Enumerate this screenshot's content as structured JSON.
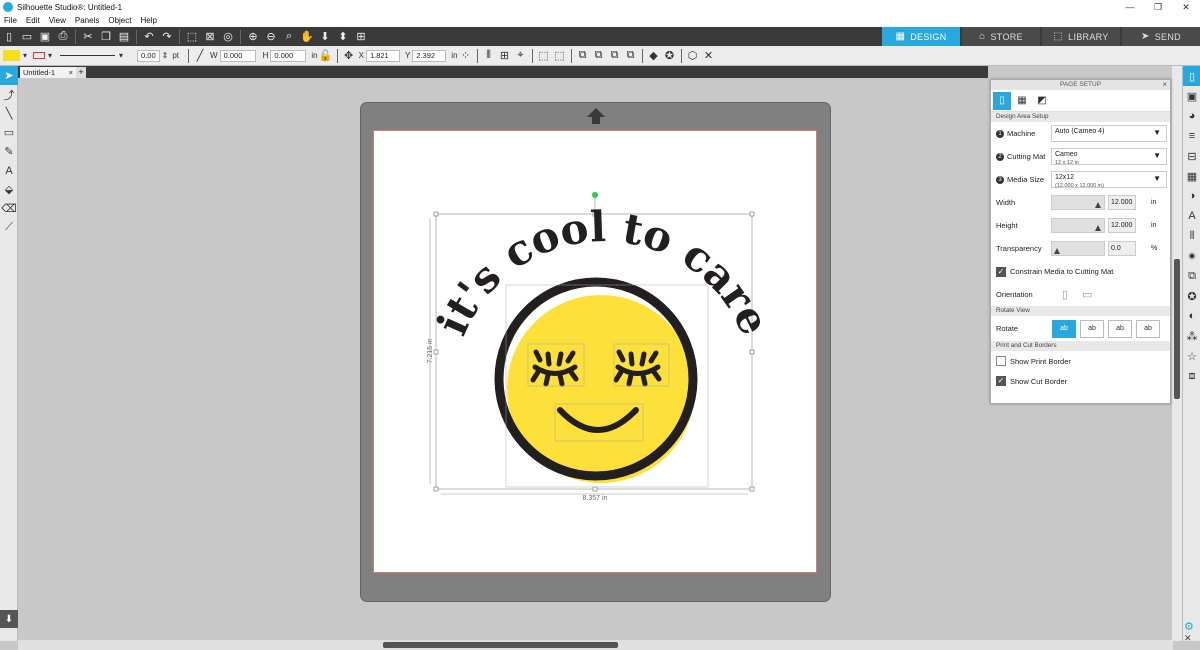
{
  "window": {
    "title": "Silhouette Studio®: Untitled-1",
    "min": "—",
    "max": "❐",
    "close": "✕"
  },
  "menu": [
    "File",
    "Edit",
    "View",
    "Panels",
    "Object",
    "Help"
  ],
  "modes": [
    {
      "label": "DESIGN",
      "icon": "▦"
    },
    {
      "label": "STORE",
      "icon": "⌂"
    },
    {
      "label": "LIBRARY",
      "icon": "⬚"
    },
    {
      "label": "SEND",
      "icon": "➤"
    }
  ],
  "props": {
    "fill_color": "#f5de1e",
    "line_width": "0.00",
    "line_unit": "pt",
    "w_label": "W",
    "w_value": "0.000",
    "h_label": "H",
    "h_value": "0.000",
    "size_unit": "in",
    "x_label": "X",
    "x_value": "1.821",
    "y_label": "Y",
    "y_value": "2.392",
    "pos_unit": "in"
  },
  "doc_tab": {
    "label": "Untitled-1",
    "close": "×",
    "add": "+"
  },
  "design": {
    "text": "it's cool to care",
    "width_label": "8.357 in",
    "height_label": "7.215 in",
    "face_color": "#fde03a",
    "ink_color": "#231f20"
  },
  "panel": {
    "title": "PAGE SETUP",
    "close": "×",
    "section_design": "Design Area Setup",
    "machine_label": "Machine",
    "machine_value": "Auto (Cameo 4)",
    "mat_label": "Cutting Mat",
    "mat_value": "Cameo",
    "mat_sub": "12 x 12 in",
    "media_label": "Media Size",
    "media_value": "12x12",
    "media_sub": "(12.000 x 12.000 in)",
    "width_label": "Width",
    "width_value": "12.000",
    "height_label": "Height",
    "height_value": "12.000",
    "unit": "in",
    "transparency_label": "Transparency",
    "transparency_value": "0.0",
    "transparency_unit": "%",
    "constrain_label": "Constrain Media to Cutting Mat",
    "orientation_label": "Orientation",
    "section_rotate": "Rotate View",
    "rotate_label": "Rotate",
    "section_borders": "Print and Cut Borders",
    "print_border_label": "Show Print Border",
    "cut_border_label": "Show Cut Border"
  }
}
